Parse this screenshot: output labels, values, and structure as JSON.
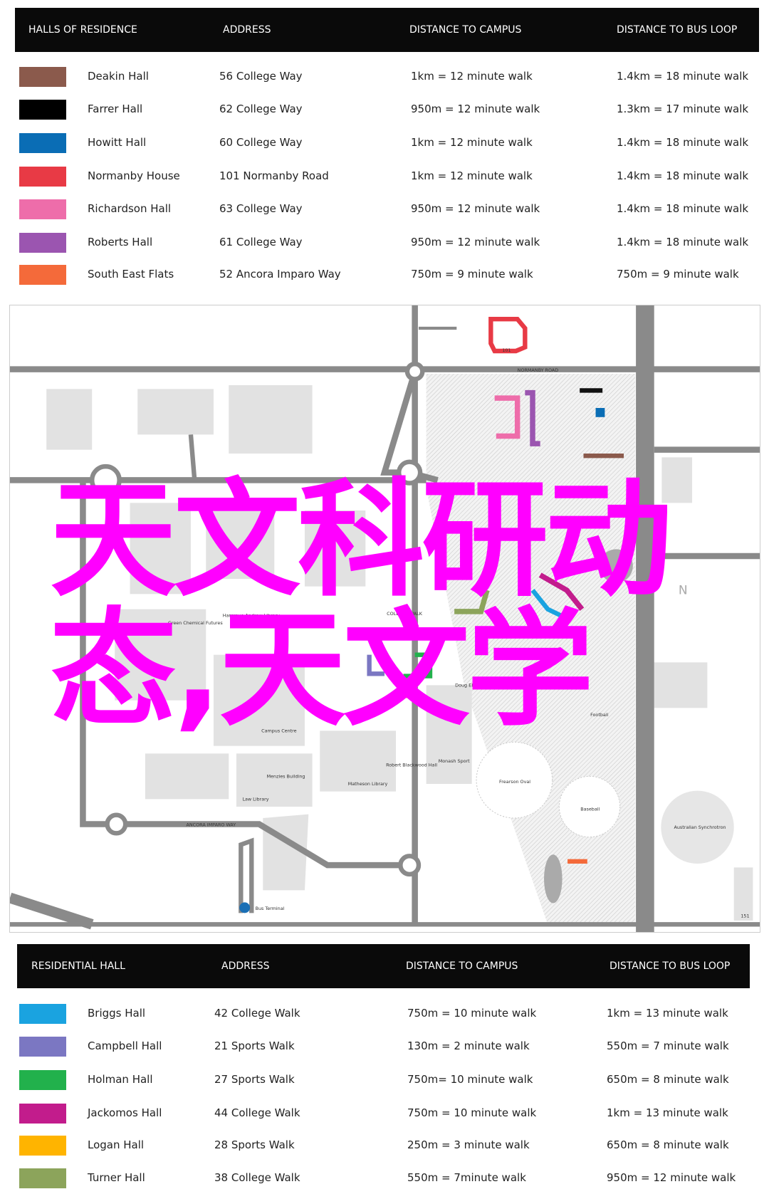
{
  "top_table": {
    "headers": [
      "HALLS OF RESIDENCE",
      "ADDRESS",
      "DISTANCE TO CAMPUS",
      "DISTANCE TO BUS LOOP"
    ],
    "rows": [
      {
        "name": "Deakin Hall",
        "address": "56 College Way",
        "campus": "1km = 12 minute walk",
        "bus": "1.4km = 18 minute walk",
        "color": "#8B5A4C"
      },
      {
        "name": "Farrer Hall",
        "address": "62 College Way",
        "campus": "950m = 12 minute walk",
        "bus": "1.3km = 17 minute walk",
        "color": "#000000"
      },
      {
        "name": "Howitt Hall",
        "address": "60 College Way",
        "campus": "1km = 12 minute walk",
        "bus": "1.4km = 18 minute walk",
        "color": "#0A6DB5"
      },
      {
        "name": "Normanby House",
        "address": "101 Normanby Road",
        "campus": "1km = 12 minute walk",
        "bus": "1.4km = 18 minute walk",
        "color": "#E83A45"
      },
      {
        "name": "Richardson Hall",
        "address": "63 College Way",
        "campus": "950m = 12 minute walk",
        "bus": "1.4km = 18 minute walk",
        "color": "#EE6DAA"
      },
      {
        "name": "Roberts Hall",
        "address": "61 College Way",
        "campus": "950m = 12 minute walk",
        "bus": "1.4km = 18 minute walk",
        "color": "#9B55B0"
      },
      {
        "name": "South East Flats",
        "address": "52 Ancora Imparo Way",
        "campus": "750m = 9 minute walk",
        "bus": "750m = 9 minute walk",
        "color": "#F46A3A"
      }
    ]
  },
  "bottom_table": {
    "headers": [
      "RESIDENTIAL HALL",
      "ADDRESS",
      "DISTANCE TO CAMPUS",
      "DISTANCE TO BUS LOOP"
    ],
    "rows": [
      {
        "name": "Briggs Hall",
        "address": "42 College Walk",
        "campus": "750m = 10 minute walk",
        "bus": "1km = 13 minute walk",
        "color": "#1AA3E0"
      },
      {
        "name": "Campbell Hall",
        "address": "21 Sports Walk",
        "campus": "130m = 2 minute walk",
        "bus": "550m = 7 minute walk",
        "color": "#7B77C2"
      },
      {
        "name": "Holman Hall",
        "address": "27 Sports Walk",
        "campus": "750m= 10 minute walk",
        "bus": "650m = 8 minute walk",
        "color": "#22B14C"
      },
      {
        "name": "Jackomos Hall",
        "address": "44 College Walk",
        "campus": "750m = 10 minute walk",
        "bus": "1km = 13 minute walk",
        "color": "#C21C8C"
      },
      {
        "name": "Logan Hall",
        "address": "28 Sports Walk",
        "campus": "250m = 3 minute walk",
        "bus": "650m = 8 minute walk",
        "color": "#FFB400"
      },
      {
        "name": "Turner Hall",
        "address": "38 College Walk",
        "campus": "550m = 7minute walk",
        "bus": "950m = 12 minute walk",
        "color": "#8CA45B"
      }
    ]
  },
  "map": {
    "labels": {
      "normanby_road": "NORMANBY ROAD",
      "college_walk": "COLLEGE WALK",
      "ancora": "ANCORA IMPARO WAY",
      "green_chem": "Green Chemical Futures",
      "hargrave": "Hargrave-Andrew Library",
      "campus_centre": "Campus Centre",
      "menzies": "Menzies Building",
      "law": "Law Library",
      "matheson": "Matheson Library",
      "robert_blackwood": "Robert Blackwood Hall",
      "monash_sport": "Monash Sport",
      "doug_ellis": "Doug Ellis Swimming Pool",
      "football": "Football",
      "frearson": "Frearson Oval",
      "baseball": "Baseball",
      "synchrotron": "Australian Synchrotron",
      "bus_terminal": "Bus Terminal",
      "n101": "101",
      "n151": "151",
      "north": "N"
    }
  },
  "overlay": {
    "line1": "天文科研动",
    "line2": "态,天文学",
    "color": "#FF00FF"
  }
}
